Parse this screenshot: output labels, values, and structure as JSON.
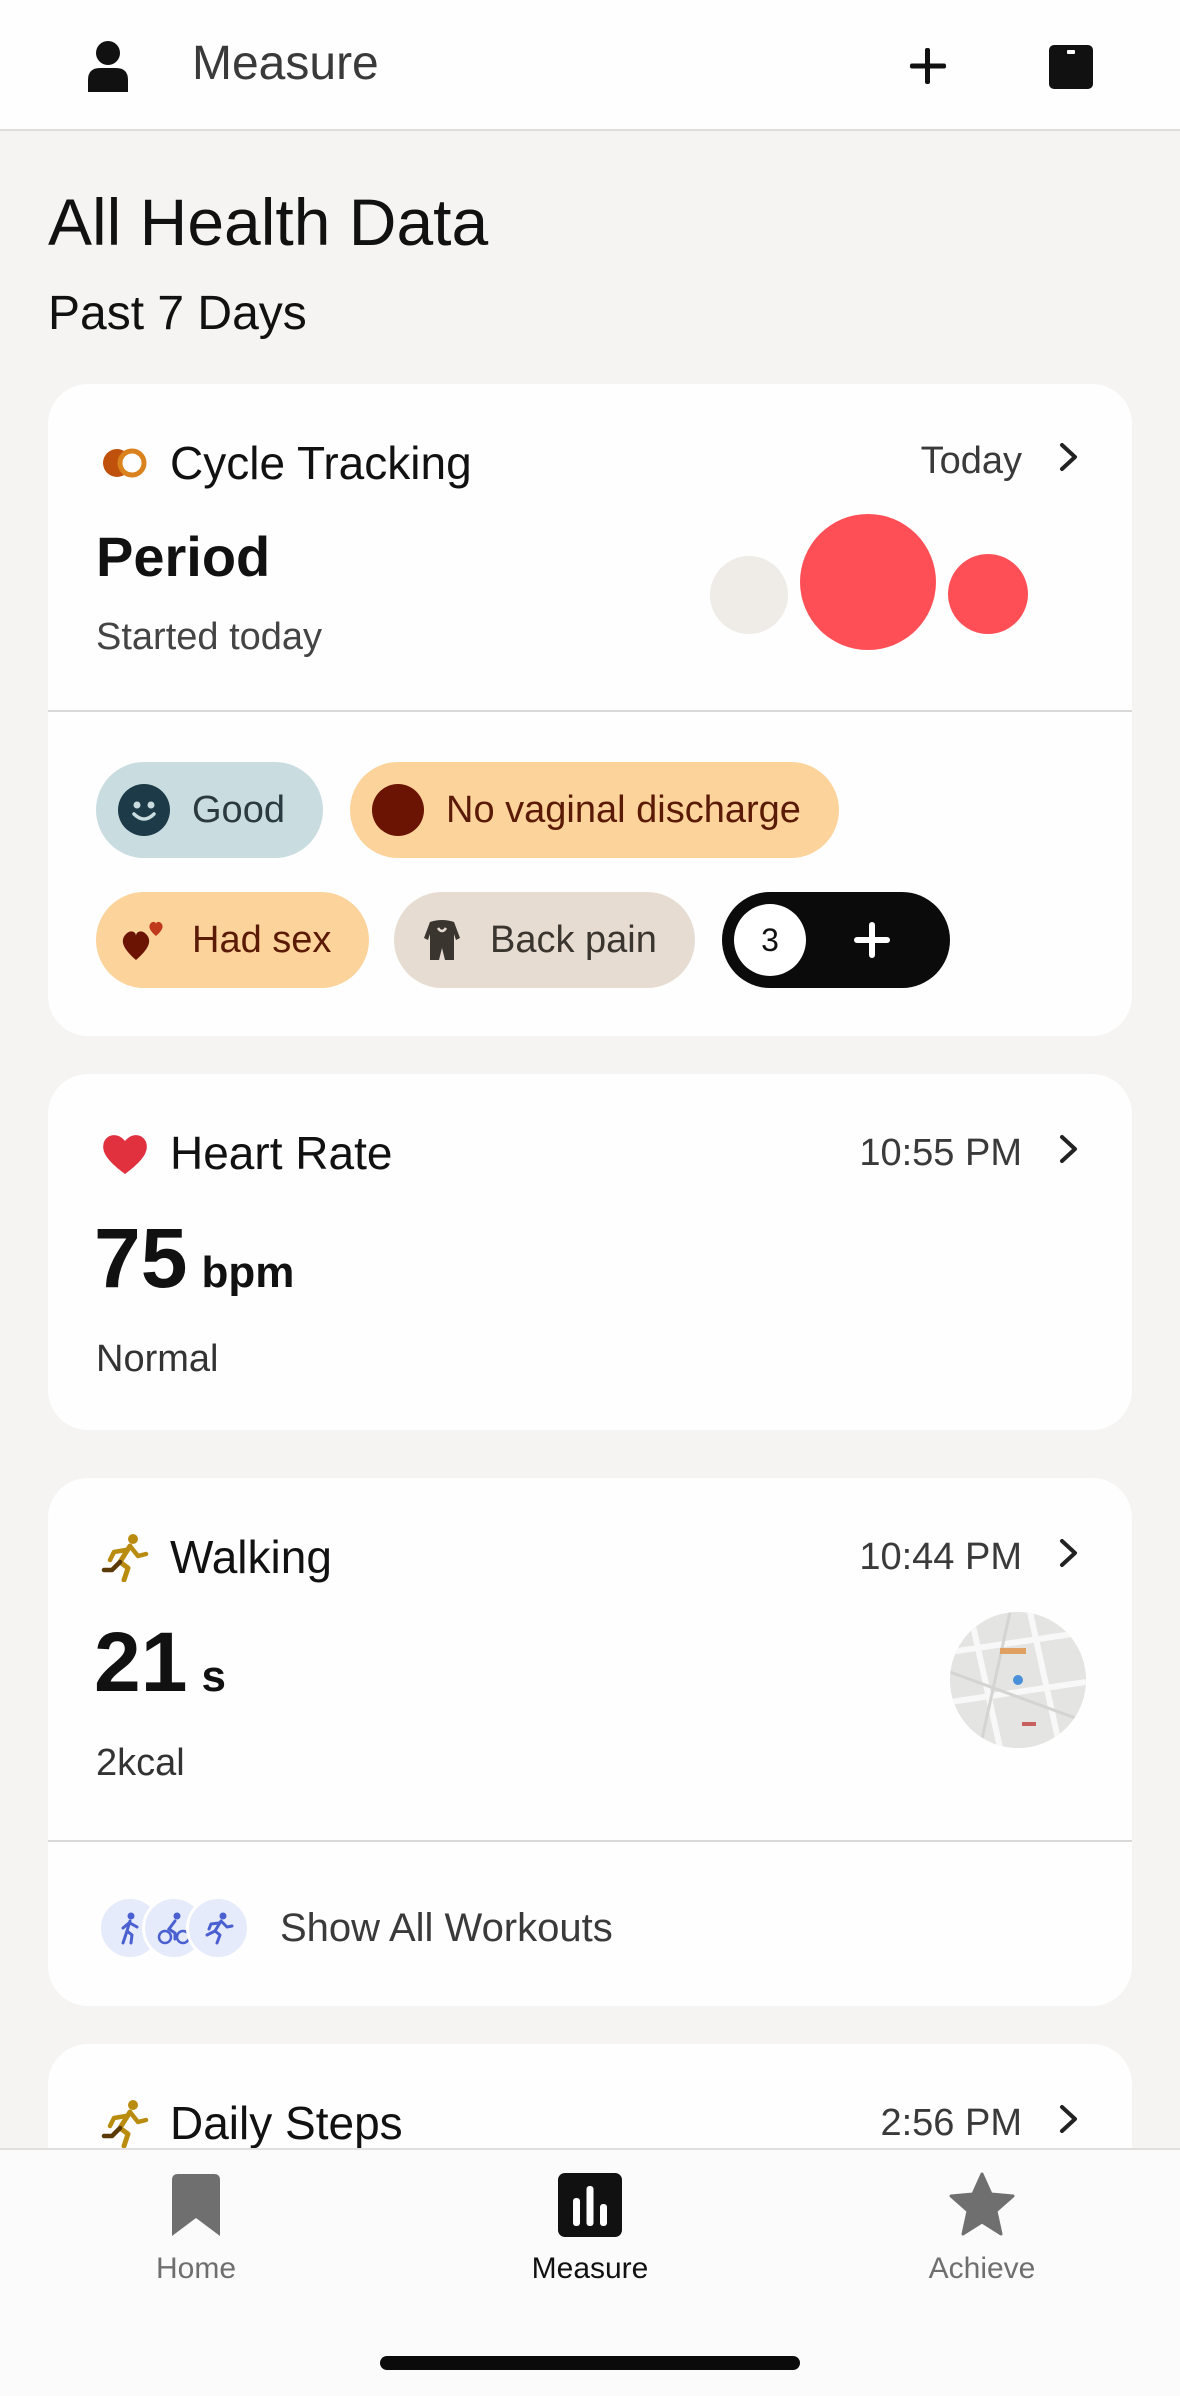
{
  "header": {
    "title": "Measure"
  },
  "page": {
    "title": "All Health Data",
    "subtitle": "Past 7 Days"
  },
  "cycle": {
    "label": "Cycle Tracking",
    "time": "Today",
    "status": "Period",
    "sub": "Started today",
    "chips": [
      {
        "label": "Good"
      },
      {
        "label": "No vaginal discharge"
      },
      {
        "label": "Had sex"
      },
      {
        "label": "Back pain"
      }
    ],
    "more_count": "3"
  },
  "heart": {
    "label": "Heart Rate",
    "time": "10:55 PM",
    "value": "75",
    "unit": "bpm",
    "sub": "Normal"
  },
  "walking": {
    "label": "Walking",
    "time": "10:44 PM",
    "value": "21",
    "unit": "s",
    "sub": "2kcal",
    "show_all": "Show All Workouts"
  },
  "steps": {
    "label": "Daily Steps",
    "time": "2:56 PM"
  },
  "nav": {
    "items": [
      {
        "label": "Home"
      },
      {
        "label": "Measure"
      },
      {
        "label": "Achieve"
      }
    ]
  },
  "colors": {
    "period_red": "#ff4f56",
    "good_chip": "#c9dde1",
    "discharge_chip": "#fbd39b",
    "backpain_chip": "#e6dcd2",
    "workout_badge": "#e5ebfa"
  }
}
